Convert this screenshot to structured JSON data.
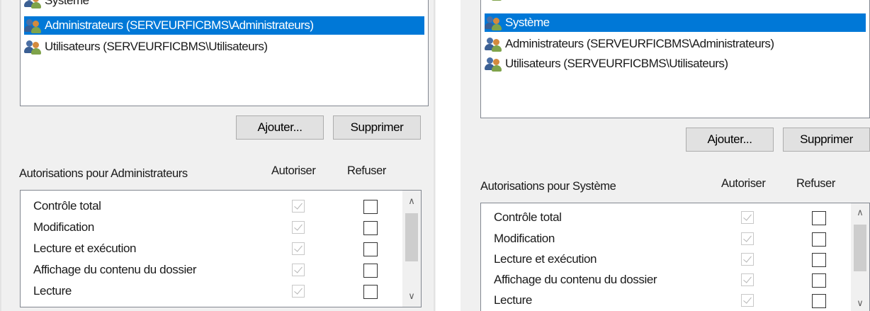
{
  "left": {
    "principals": [
      {
        "label": "Système",
        "selected": false,
        "icon": "users-group-icon"
      },
      {
        "label": "Administrateurs (SERVEURFICBMS\\Administrateurs)",
        "selected": true,
        "icon": "users-group-icon"
      },
      {
        "label": "Utilisateurs (SERVEURFICBMS\\Utilisateurs)",
        "selected": false,
        "icon": "users-group-icon"
      }
    ],
    "add_label": "Ajouter...",
    "remove_label": "Supprimer",
    "permissions_title": "Autorisations pour Administrateurs",
    "allow_header": "Autoriser",
    "deny_header": "Refuser",
    "permissions": [
      {
        "name": "Contrôle total",
        "allow": true,
        "deny": false
      },
      {
        "name": "Modification",
        "allow": true,
        "deny": false
      },
      {
        "name": "Lecture et exécution",
        "allow": true,
        "deny": false
      },
      {
        "name": "Affichage du contenu du dossier",
        "allow": true,
        "deny": false
      },
      {
        "name": "Lecture",
        "allow": true,
        "deny": false
      }
    ]
  },
  "right": {
    "principals": [
      {
        "label": "Système",
        "selected": true,
        "icon": "users-group-icon"
      },
      {
        "label": "Administrateurs (SERVEURFICBMS\\Administrateurs)",
        "selected": false,
        "icon": "users-group-icon"
      },
      {
        "label": "Utilisateurs (SERVEURFICBMS\\Utilisateurs)",
        "selected": false,
        "icon": "users-group-icon"
      }
    ],
    "add_label": "Ajouter...",
    "remove_label": "Supprimer",
    "permissions_title": "Autorisations pour Système",
    "allow_header": "Autoriser",
    "deny_header": "Refuser",
    "permissions": [
      {
        "name": "Contrôle total",
        "allow": true,
        "deny": false
      },
      {
        "name": "Modification",
        "allow": true,
        "deny": false
      },
      {
        "name": "Lecture et exécution",
        "allow": true,
        "deny": false
      },
      {
        "name": "Affichage du contenu du dossier",
        "allow": true,
        "deny": false
      },
      {
        "name": "Lecture",
        "allow": true,
        "deny": false
      }
    ]
  },
  "colors": {
    "selection": "#0078d7",
    "dialog_bg": "#f0f0f0",
    "button_bg": "#e1e1e1"
  }
}
